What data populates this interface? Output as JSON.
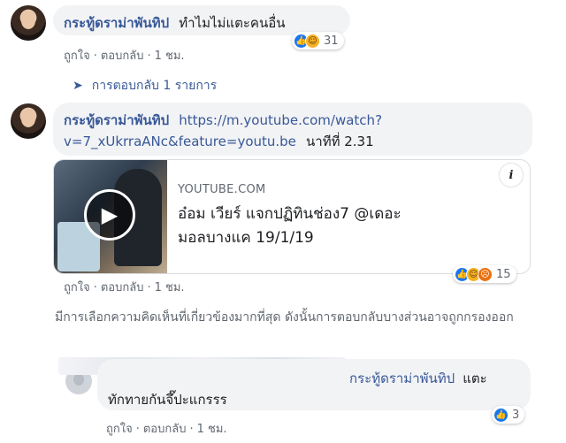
{
  "comment1": {
    "author": "กระทู้ดราม่าพันทิป",
    "text": "ทำไมไม่แตะคนอื่น",
    "reaction_count": "31",
    "like_label": "ถูกใจ",
    "reply_label": "ตอบกลับ",
    "time": "1 ชม.",
    "view_replies": "การตอบกลับ 1 รายการ"
  },
  "comment2": {
    "author": "กระทู้ดราม่าพันทิป",
    "link_line1": "https://m.youtube.com/watch?",
    "link_line2": "v=7_xUkrraANc&feature=youtu.be",
    "suffix": "นาทีที่ 2.31",
    "preview_domain": "YOUTUBE.COM",
    "preview_title": "อ๋อม เวียร์ แจกปฏิทินช่อง7 @เดอะมอลบางแค 19/1/19",
    "reaction_count": "15",
    "like_label": "ถูกใจ",
    "reply_label": "ตอบกลับ",
    "time": "1 ชม."
  },
  "notice": "มีการเลือกความคิดเห็นที่เกี่ยวข้องมากที่สุด ดังนั้นการตอบกลับบางส่วนอาจถูกกรองออก",
  "comment3": {
    "mention": "กระทู้ดราม่าพันทิป",
    "text_line1": "แตะ",
    "text_line2": "ทักทายกันจึ๊ปะแกรรร",
    "reaction_count": "3",
    "like_label": "ถูกใจ",
    "reply_label": "ตอบกลับ",
    "time": "1 ชม."
  },
  "icons": {
    "like": "thumbs-up-icon",
    "haha": "haha-icon",
    "angry": "angry-icon",
    "reply_arrow": "reply-arrow-icon",
    "play": "play-icon",
    "info": "info-icon"
  },
  "colors": {
    "link": "#385898",
    "bubble": "#f2f3f5",
    "meta": "#606770",
    "like": "#1877f2"
  }
}
